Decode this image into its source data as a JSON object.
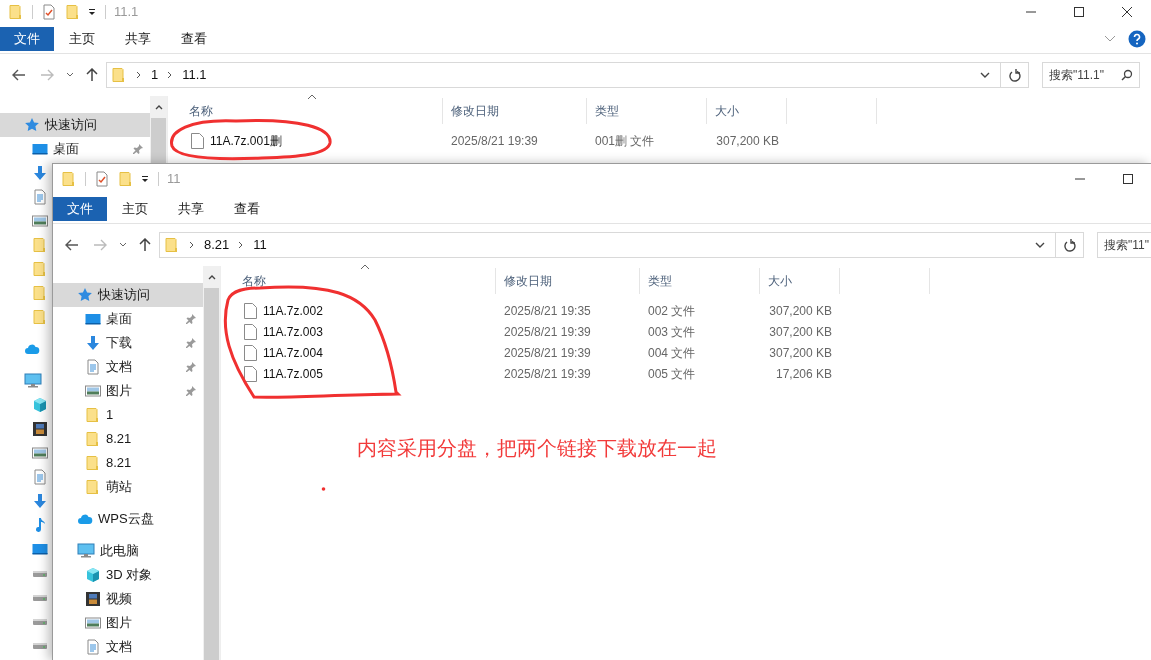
{
  "back_window": {
    "title": "11.1",
    "ribbon_tabs": [
      {
        "label": "文件",
        "kind": "file"
      },
      {
        "label": "主页",
        "kind": "tab"
      },
      {
        "label": "共享",
        "kind": "tab"
      },
      {
        "label": "查看",
        "kind": "tab"
      }
    ],
    "path": [
      "1",
      "11.1"
    ],
    "search": {
      "placeholder": "搜索\"11.1\""
    },
    "sidebar": {
      "items": [
        {
          "label": "快速访问",
          "kind": "star",
          "selected": true,
          "children": [
            {
              "label": "桌面",
              "kind": "desktop",
              "pinned": true,
              "selected": false
            },
            {
              "kind": "download",
              "selected": false
            },
            {
              "kind": "docs",
              "selected": false
            },
            {
              "kind": "pictures",
              "selected": false
            },
            {
              "kind": "folder",
              "selected": false
            },
            {
              "kind": "folder",
              "selected": false
            },
            {
              "kind": "folder",
              "selected": false
            },
            {
              "kind": "folder",
              "selected": false
            }
          ]
        },
        {
          "kind": "cloud",
          "selected": false
        },
        {
          "kind": "pc",
          "selected": false,
          "children": [
            {
              "kind": "cube",
              "selected": false
            },
            {
              "kind": "video",
              "selected": false
            },
            {
              "kind": "pictures",
              "selected": false
            },
            {
              "kind": "docs",
              "selected": false
            },
            {
              "kind": "download",
              "selected": false
            },
            {
              "kind": "music",
              "selected": false
            },
            {
              "kind": "desktop",
              "selected": false
            },
            {
              "kind": "drive",
              "selected": false
            },
            {
              "kind": "drive",
              "selected": false
            },
            {
              "kind": "drive",
              "selected": false
            },
            {
              "kind": "drive",
              "selected": false
            }
          ]
        }
      ]
    },
    "columns": [
      "名称",
      "修改日期",
      "类型",
      "大小"
    ],
    "rows": [
      {
        "name": "11A.7z.001删",
        "modified": "2025/8/21 19:39",
        "type": "001删 文件",
        "size": "307,200 KB"
      }
    ]
  },
  "front_window": {
    "title": "11",
    "ribbon_tabs": [
      {
        "label": "文件",
        "kind": "file"
      },
      {
        "label": "主页",
        "kind": "tab"
      },
      {
        "label": "共享",
        "kind": "tab"
      },
      {
        "label": "查看",
        "kind": "tab"
      }
    ],
    "path": [
      "8.21",
      "11"
    ],
    "search": {
      "placeholder": "搜索\"11\""
    },
    "sidebar": {
      "items": [
        {
          "label": "快速访问",
          "kind": "star",
          "selected": true,
          "children": [
            {
              "label": "桌面",
              "kind": "desktop",
              "pinned": true,
              "selected": false
            },
            {
              "label": "下载",
              "kind": "download",
              "pinned": true,
              "selected": false
            },
            {
              "label": "文档",
              "kind": "docs",
              "pinned": true,
              "selected": false
            },
            {
              "label": "图片",
              "kind": "pictures",
              "pinned": true,
              "selected": false
            },
            {
              "label": "1",
              "kind": "folder",
              "selected": false
            },
            {
              "label": "8.21",
              "kind": "folder",
              "selected": false
            },
            {
              "label": "8.21",
              "kind": "folder",
              "selected": false
            },
            {
              "label": "萌站",
              "kind": "folder",
              "selected": false
            }
          ]
        },
        {
          "label": "WPS云盘",
          "kind": "cloud",
          "selected": false
        },
        {
          "label": "此电脑",
          "kind": "pc",
          "selected": false,
          "children": [
            {
              "label": "3D 对象",
              "kind": "cube",
              "selected": false
            },
            {
              "label": "视频",
              "kind": "video",
              "selected": false
            },
            {
              "label": "图片",
              "kind": "pictures",
              "selected": false
            },
            {
              "label": "文档",
              "kind": "docs",
              "selected": false
            }
          ]
        }
      ]
    },
    "columns": [
      "名称",
      "修改日期",
      "类型",
      "大小"
    ],
    "rows": [
      {
        "name": "11A.7z.002",
        "modified": "2025/8/21 19:35",
        "type": "002 文件",
        "size": "307,200 KB"
      },
      {
        "name": "11A.7z.003",
        "modified": "2025/8/21 19:39",
        "type": "003 文件",
        "size": "307,200 KB"
      },
      {
        "name": "11A.7z.004",
        "modified": "2025/8/21 19:39",
        "type": "004 文件",
        "size": "307,200 KB"
      },
      {
        "name": "11A.7z.005",
        "modified": "2025/8/21 19:39",
        "type": "005 文件",
        "size": "17,206 KB"
      }
    ]
  },
  "annotation": {
    "text": "内容采用分盘，把两个链接下载放在一起"
  }
}
